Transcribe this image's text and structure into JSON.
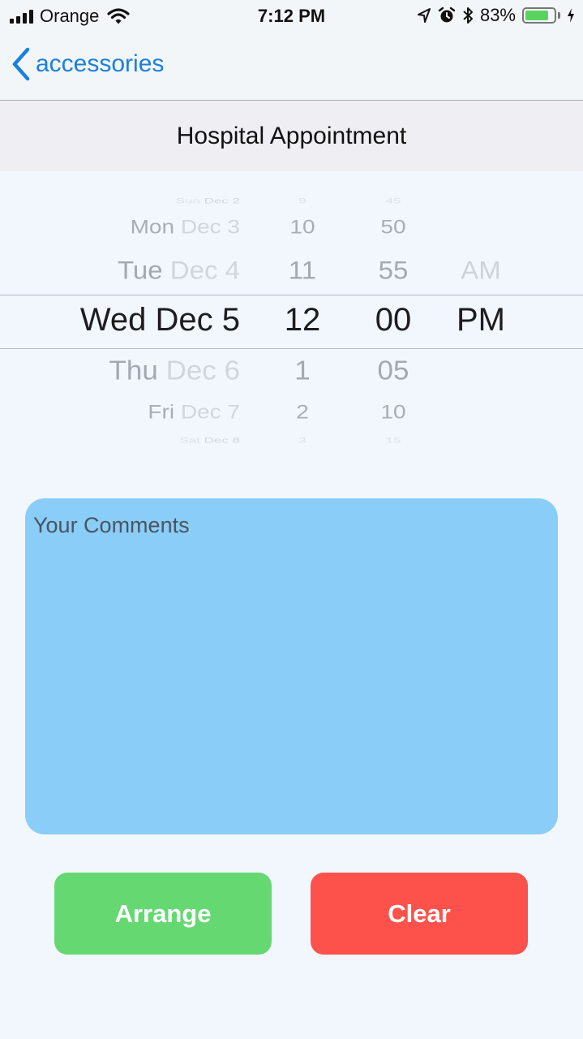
{
  "status_bar": {
    "carrier": "Orange",
    "time": "7:12 PM",
    "battery_percent": "83%",
    "battery_level": 0.83,
    "icons": [
      "signal-icon",
      "wifi-icon",
      "location-arrow-icon",
      "alarm-icon",
      "bluetooth-icon",
      "battery-icon",
      "charging-bolt-icon"
    ]
  },
  "nav": {
    "back_label": "accessories"
  },
  "header": {
    "title": "Hospital Appointment"
  },
  "picker": {
    "date": [
      "Sun Dec 2",
      "Mon Dec 3",
      "Tue Dec 4",
      "Wed Dec 5",
      "Thu Dec 6",
      "Fri Dec 7",
      "Sat Dec 8"
    ],
    "hour": [
      "9",
      "10",
      "11",
      "12",
      "1",
      "2",
      "3"
    ],
    "minute": [
      "45",
      "50",
      "55",
      "00",
      "05",
      "10",
      "15"
    ],
    "ampm": [
      "",
      "",
      "AM",
      "PM",
      "",
      "",
      ""
    ],
    "selected": {
      "date": "Wed Dec 5",
      "hour": "12",
      "minute": "00",
      "ampm": "PM"
    }
  },
  "comments": {
    "placeholder": "Your Comments"
  },
  "buttons": {
    "arrange": "Arrange",
    "clear": "Clear"
  },
  "colors": {
    "accent": "#1b7fe0",
    "comments_bg": "#89cdf8",
    "arrange_bg": "#66d872",
    "clear_bg": "#fd524c",
    "battery": "#5bd35f"
  }
}
